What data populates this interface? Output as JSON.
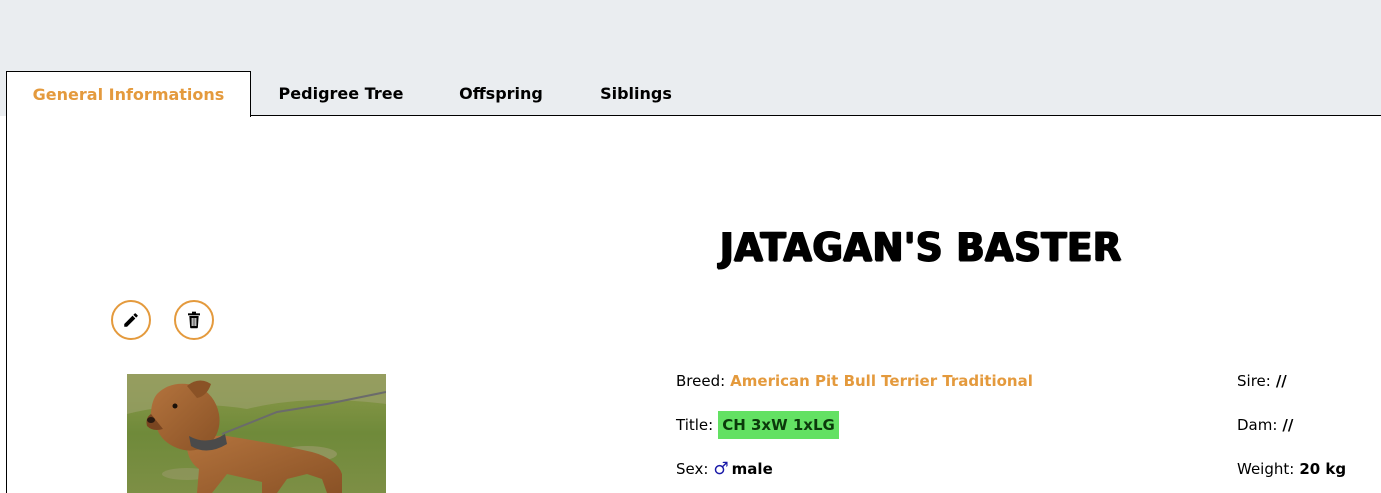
{
  "tabs": [
    {
      "label": "General Informations",
      "active": true
    },
    {
      "label": "Pedigree Tree",
      "active": false
    },
    {
      "label": "Offspring",
      "active": false
    },
    {
      "label": "Siblings",
      "active": false
    }
  ],
  "dog": {
    "name": "JATAGAN'S BASTER",
    "breed_label": "Breed:",
    "breed": "American Pit Bull Terrier Traditional",
    "title_label": "Title:",
    "title": "CH 3xW 1xLG",
    "sex_label": "Sex:",
    "sex_symbol": "♂",
    "sex": "male",
    "sire_label": "Sire:",
    "sire": "//",
    "dam_label": "Dam:",
    "dam": "//",
    "weight_label": "Weight:",
    "weight": "20 kg"
  },
  "actions": {
    "edit_icon": "pencil-icon",
    "delete_icon": "trash-icon"
  },
  "colors": {
    "accent": "#e49a3d",
    "title_badge": "#63e163",
    "header_bg": "#eaedf0",
    "male": "#1a1aa8"
  }
}
